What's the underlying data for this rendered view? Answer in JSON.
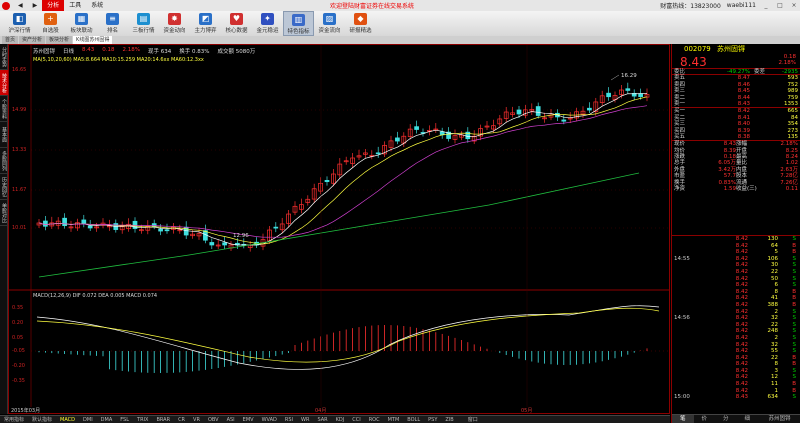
{
  "menubar": {
    "items": [
      "分析",
      "工具",
      "系统"
    ],
    "active_index": 0,
    "marquee": "欢迎登陆财富证券在线交易系统",
    "hotline": "财富热线：13823000",
    "user": "waebi111"
  },
  "toolbar": {
    "items": [
      {
        "label": "沪深行情",
        "color": "#1c5fb0",
        "glyph": "◧"
      },
      {
        "label": "自选股",
        "color": "#e06010",
        "glyph": "+"
      },
      {
        "label": "板块联动",
        "color": "#2a70c8",
        "glyph": "▦"
      },
      {
        "label": "排名",
        "color": "#2a70c8",
        "glyph": "≡"
      },
      {
        "label": "三板行情",
        "color": "#1c8fd0",
        "glyph": "▤"
      },
      {
        "label": "资金动向",
        "color": "#d03030",
        "glyph": "✸"
      },
      {
        "label": "主力博弈",
        "color": "#2a70c8",
        "glyph": "◩"
      },
      {
        "label": "核心数据",
        "color": "#d03030",
        "glyph": "♥"
      },
      {
        "label": "金元稳运",
        "color": "#3050c0",
        "glyph": "✦"
      },
      {
        "label": "特色指标",
        "color": "#3a6ac8",
        "glyph": "▥"
      },
      {
        "label": "资金流向",
        "color": "#2a70c8",
        "glyph": "▨"
      },
      {
        "label": "研报精选",
        "color": "#e05010",
        "glyph": "◆"
      }
    ],
    "active_index": 9
  },
  "tabs": {
    "items": [
      "首页",
      "资产分析",
      "板块分析",
      "K线图苏州固锝"
    ],
    "active_index": 3
  },
  "sidetabs": {
    "items": [
      "分时走势",
      "技术分析",
      "个股资料",
      "基本面",
      "多股同列",
      "历史回忆",
      "单股对比"
    ],
    "active_index": 1
  },
  "chart": {
    "stock_name": "苏州固锝",
    "period": "日线",
    "price": "8.43",
    "change": "0.18",
    "pct": "2.18%",
    "info_extra": [
      "现手 634",
      "换手 0.83%",
      "成交额 5080万"
    ],
    "ma_text": "MA(5,10,20,60)  MA5:8.664  MA10:15.259  MA20:14.6xx  MA60:12.3xx",
    "macd_text": "MACD(12,26,9)  DIF 0.072  DEA 0.005  MACD 0.074",
    "high_label": "16.29",
    "low_label": "12.96",
    "price_axis": [
      "16.65",
      "14.99",
      "13.33",
      "11.67",
      "10.01"
    ],
    "macd_axis": [
      "0.35",
      "0.20",
      "0.05",
      "-0.05",
      "-0.20",
      "-0.35"
    ],
    "date_start": "2015年03月",
    "date_marks": [
      "04月",
      "05月"
    ]
  },
  "indicators": {
    "items": [
      "常用指标",
      "默认指标",
      "MACD",
      "DMI",
      "DMA",
      "FSL",
      "TRIX",
      "BRAR",
      "CR",
      "VR",
      "OBV",
      "ASI",
      "EMV",
      "WVAD",
      "RSI",
      "WR",
      "SAR",
      "KDJ",
      "CCI",
      "ROC",
      "MTM",
      "BOLL",
      "PSY",
      "ZIB"
    ],
    "active_index": 2,
    "window_label": "窗口"
  },
  "quote": {
    "code": "002079",
    "name": "苏州固锝",
    "price": "8.43",
    "change": "0.18",
    "pct": "2.18%",
    "ratio_label": "委比",
    "ratio": "-49.27%",
    "diff_label": "委差",
    "diff": "-2935",
    "asks": [
      [
        "卖五",
        "8.47",
        "593"
      ],
      [
        "卖四",
        "8.46",
        "752"
      ],
      [
        "卖三",
        "8.45",
        "989"
      ],
      [
        "卖二",
        "8.44",
        "759"
      ],
      [
        "卖一",
        "8.43",
        "1353"
      ]
    ],
    "bids": [
      [
        "买一",
        "8.42",
        "665"
      ],
      [
        "买二",
        "8.41",
        "84"
      ],
      [
        "买三",
        "8.40",
        "354"
      ],
      [
        "买四",
        "8.39",
        "273"
      ],
      [
        "买五",
        "8.38",
        "135"
      ]
    ],
    "stats": [
      [
        "现价",
        "8.43",
        "涨幅",
        "2.18%"
      ],
      [
        "均价",
        "8.39",
        "开盘",
        "8.25"
      ],
      [
        "涨跌",
        "0.18",
        "最高",
        "8.24"
      ],
      [
        "总手",
        "6.05万",
        "量比",
        "1.02"
      ],
      [
        "外盘",
        "3.42万",
        "内盘",
        "2.63万"
      ],
      [
        "市盈",
        "57.7",
        "股本",
        "7.28亿"
      ],
      [
        "换手",
        "0.83%",
        "流通",
        "7.26亿"
      ],
      [
        "净资",
        "1.59",
        "收益(三)",
        "0.11"
      ]
    ],
    "ticks": [
      [
        "",
        "8.42",
        "130",
        "S"
      ],
      [
        "",
        "8.42",
        "64",
        "B"
      ],
      [
        "",
        "8.42",
        "5",
        "B"
      ],
      [
        "14:55",
        "8.42",
        "106",
        "S"
      ],
      [
        "",
        "8.42",
        "30",
        "S"
      ],
      [
        "",
        "8.42",
        "22",
        "S"
      ],
      [
        "",
        "8.42",
        "50",
        "S"
      ],
      [
        "",
        "8.42",
        "6",
        "S"
      ],
      [
        "",
        "8.42",
        "8",
        "B"
      ],
      [
        "",
        "8.42",
        "41",
        "B"
      ],
      [
        "",
        "8.42",
        "388",
        "B"
      ],
      [
        "",
        "8.42",
        "2",
        "S"
      ],
      [
        "14:56",
        "8.42",
        "32",
        "S"
      ],
      [
        "",
        "8.42",
        "22",
        "S"
      ],
      [
        "",
        "8.42",
        "248",
        "S"
      ],
      [
        "",
        "8.42",
        "2",
        "S"
      ],
      [
        "",
        "8.42",
        "32",
        "S"
      ],
      [
        "",
        "8.42",
        "55",
        "S"
      ],
      [
        "",
        "8.42",
        "22",
        "B"
      ],
      [
        "",
        "8.42",
        "8",
        "B"
      ],
      [
        "",
        "8.42",
        "3",
        "S"
      ],
      [
        "",
        "8.42",
        "12",
        "S"
      ],
      [
        "",
        "8.42",
        "11",
        "B"
      ],
      [
        "",
        "8.42",
        "1",
        "B"
      ],
      [
        "15:00",
        "8.43",
        "634",
        "S"
      ]
    ],
    "bottom_tabs": [
      "笔",
      "价",
      "分",
      "细"
    ],
    "bottom_active": 0,
    "footer_name": "苏州固锝"
  }
}
